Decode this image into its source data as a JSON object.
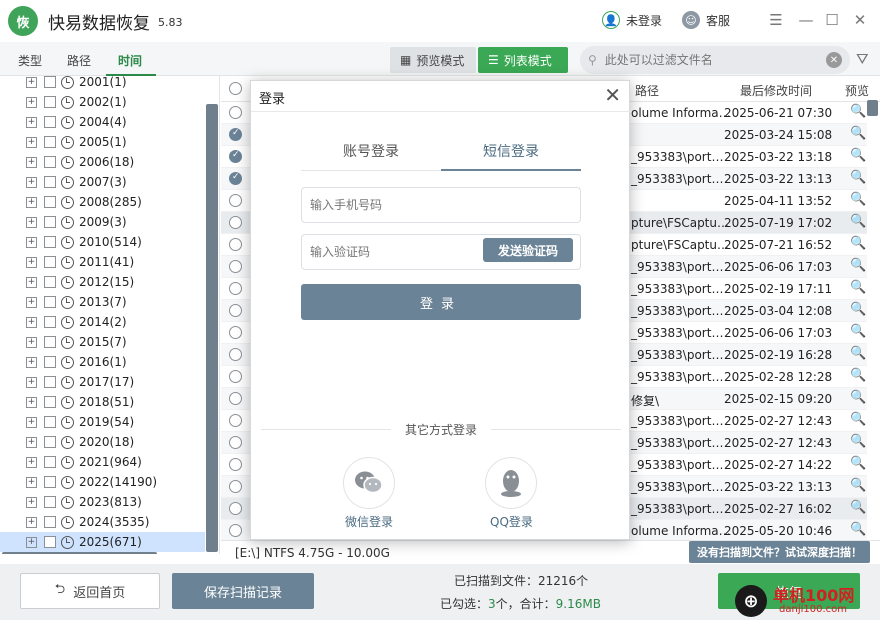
{
  "app": {
    "logo": "恢",
    "title": "快易数据恢复",
    "version": "5.83"
  },
  "titlebar": {
    "user_label": "未登录",
    "service_label": "客服"
  },
  "tabs": [
    {
      "label": "类型"
    },
    {
      "label": "路径"
    },
    {
      "label": "时间"
    }
  ],
  "view_modes": {
    "preview": "预览模式",
    "list": "列表模式"
  },
  "search": {
    "placeholder": "此处可以过滤文件名"
  },
  "tree": [
    "2001(1)",
    "2002(1)",
    "2004(4)",
    "2005(1)",
    "2006(18)",
    "2007(3)",
    "2008(285)",
    "2009(3)",
    "2010(514)",
    "2011(41)",
    "2012(15)",
    "2013(7)",
    "2014(2)",
    "2015(7)",
    "2016(1)",
    "2017(17)",
    "2018(51)",
    "2019(54)",
    "2020(18)",
    "2021(964)",
    "2022(14190)",
    "2023(813)",
    "2024(3535)",
    "2025(671)"
  ],
  "list_headers": {
    "path": "路径",
    "modified": "最后修改时间",
    "preview": "预览"
  },
  "rows": [
    {
      "path": "olume Informa…",
      "date": "2025-06-21  07:30"
    },
    {
      "path": "",
      "date": "2025-03-24  15:08"
    },
    {
      "path": "_953383\\port…",
      "date": "2025-03-22  13:18"
    },
    {
      "path": "_953383\\port…",
      "date": "2025-03-22  13:13"
    },
    {
      "path": "",
      "date": "2025-04-11  13:52"
    },
    {
      "path": "pture\\FSCaptu…",
      "date": "2025-07-19  17:02"
    },
    {
      "path": "pture\\FSCaptu…",
      "date": "2025-07-21  16:52"
    },
    {
      "path": "_953383\\port…",
      "date": "2025-06-06  17:03"
    },
    {
      "path": "_953383\\port…",
      "date": "2025-02-19  17:11"
    },
    {
      "path": "_953383\\port…",
      "date": "2025-03-04  12:08"
    },
    {
      "path": "_953383\\port…",
      "date": "2025-06-06  17:03"
    },
    {
      "path": "_953383\\port…",
      "date": "2025-02-19  16:28"
    },
    {
      "path": "_953383\\port…",
      "date": "2025-02-28  12:28"
    },
    {
      "path": "修复\\",
      "date": "2025-02-15  09:20"
    },
    {
      "path": "_953383\\port…",
      "date": "2025-02-27  12:43"
    },
    {
      "path": "_953383\\port…",
      "date": "2025-02-27  12:43"
    },
    {
      "path": "_953383\\port…",
      "date": "2025-02-27  14:22"
    },
    {
      "path": "_953383\\port…",
      "date": "2025-03-22  13:13"
    },
    {
      "path": "_953383\\port…",
      "date": "2025-02-27  16:02"
    },
    {
      "path": "olume Informa…",
      "date": "2025-05-20  10:46"
    }
  ],
  "status": {
    "disk": "[E:\\] NTFS 4.75G - 10.00G",
    "deep_scan": "没有扫描到文件？试试深度扫描！"
  },
  "bottom": {
    "back": "返回首页",
    "save": "保存扫描记录",
    "scanned": "已扫描到文件：21216个",
    "selected_prefix": "已勾选：",
    "selected_count": "3",
    "selected_mid": "个，合计：",
    "selected_size": "9.16MB",
    "recover": "恢复"
  },
  "watermark": {
    "text": "单机100网",
    "sub": "danji100.com"
  },
  "dialog": {
    "title": "登录",
    "tab_account": "账号登录",
    "tab_sms": "短信登录",
    "phone_placeholder": "输入手机号码",
    "code_placeholder": "输入验证码",
    "send_code": "发送验证码",
    "login": "登录",
    "other": "其它方式登录",
    "wechat": "微信登录",
    "qq": "QQ登录"
  }
}
